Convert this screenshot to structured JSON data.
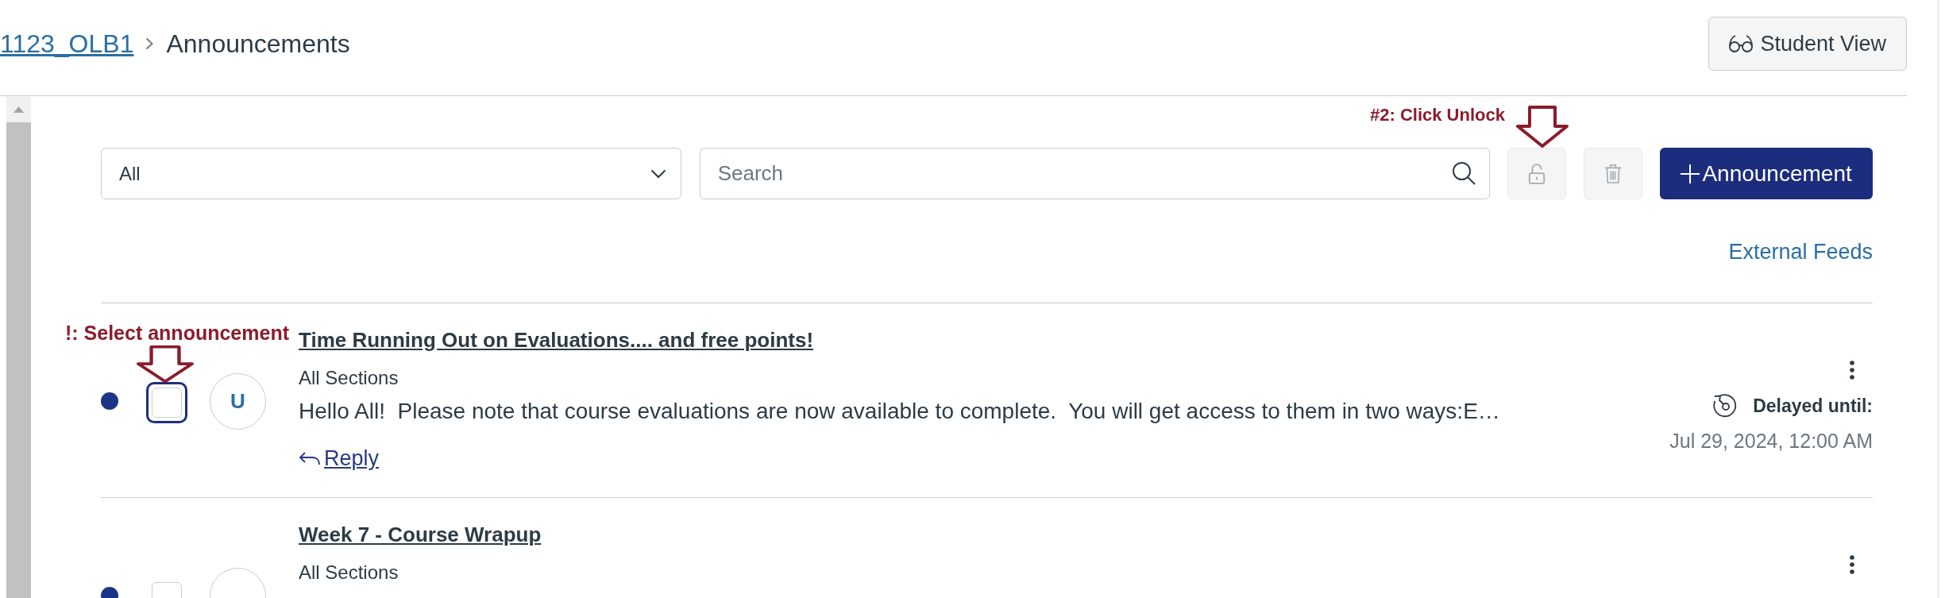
{
  "breadcrumb": {
    "course": "1123_OLB1",
    "current": "Announcements"
  },
  "student_view_button": {
    "label": "Student View"
  },
  "filter": {
    "value": "All"
  },
  "search": {
    "placeholder": "Search"
  },
  "toolbar_annotation": {
    "text": "#2: Click Unlock"
  },
  "toolbar_buttons": [
    {
      "kind": "unlock",
      "disabled": true
    },
    {
      "kind": "delete",
      "disabled": true
    }
  ],
  "add_button": {
    "label": "Announcement"
  },
  "external_feeds": "External Feeds",
  "announcements": [
    {
      "annotation": "!: Select announcement",
      "unread": true,
      "checked": false,
      "focused": true,
      "avatar": "U",
      "title": "Time Running Out on Evaluations.... and free points!",
      "sections": "All Sections",
      "body": "Hello All!  Please note that course evaluations are now available to complete.  You will get access to them in two ways:E…",
      "reply": "Reply",
      "delayed_label": "Delayed until:",
      "delayed_date": "Jul 29, 2024, 12:00 AM"
    },
    {
      "unread": true,
      "checked": false,
      "focused": false,
      "title": "Week 7 - Course Wrapup",
      "sections": "All Sections"
    }
  ]
}
